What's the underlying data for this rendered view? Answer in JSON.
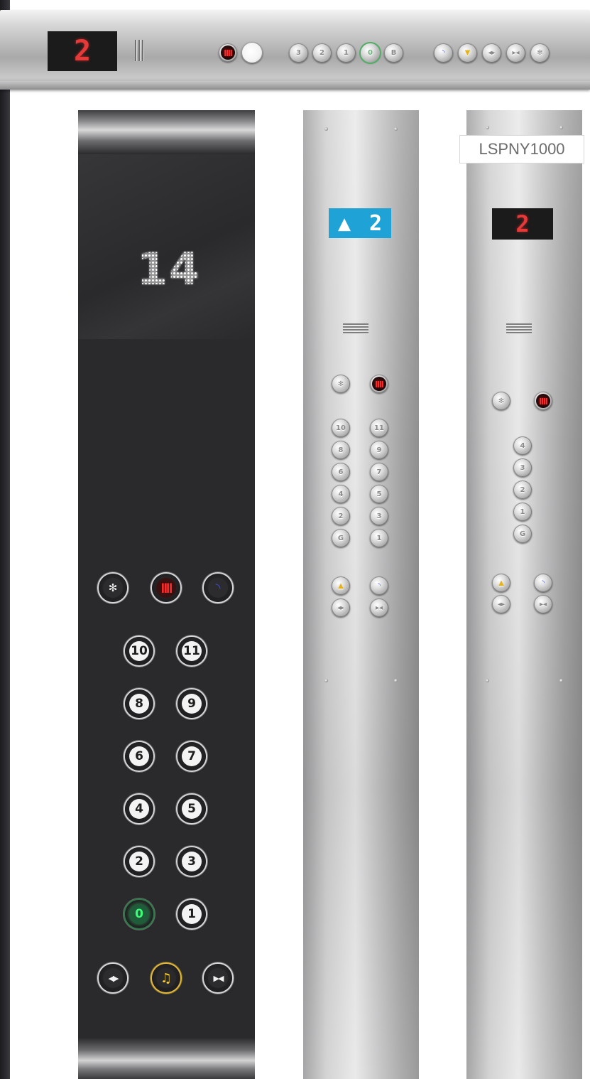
{
  "top_panel": {
    "floor_display": "2",
    "buttons": [
      "3",
      "2",
      "1",
      "0",
      "B"
    ],
    "right_buttons": [
      "",
      "",
      "",
      "",
      ""
    ]
  },
  "black_panel": {
    "floor_display": "14",
    "function_row": [
      {
        "name": "fan",
        "glyph": "✻",
        "style": "dark"
      },
      {
        "name": "alarm",
        "glyph": "ǁǁ",
        "style": "red"
      },
      {
        "name": "phone",
        "glyph": "◝",
        "style": "blue"
      }
    ],
    "floor_buttons": [
      [
        "10",
        "11"
      ],
      [
        "8",
        "9"
      ],
      [
        "6",
        "7"
      ],
      [
        "4",
        "5"
      ],
      [
        "2",
        "3"
      ],
      [
        "0",
        "1"
      ]
    ],
    "bottom_row": [
      {
        "name": "door-open",
        "glyph": "◀▶",
        "style": "dark"
      },
      {
        "name": "alarm-bell",
        "glyph": "♫",
        "style": "yellow"
      },
      {
        "name": "door-close",
        "glyph": "▶◀",
        "style": "dark"
      }
    ]
  },
  "steel_panel_1": {
    "direction_arrow": "▲",
    "floor_display": "2",
    "floor_buttons": [
      [
        "10",
        "11"
      ],
      [
        "8",
        "9"
      ],
      [
        "6",
        "7"
      ],
      [
        "4",
        "5"
      ],
      [
        "2",
        "3"
      ],
      [
        "G",
        "1"
      ]
    ]
  },
  "steel_panel_2": {
    "model_label": "LSPNY1000",
    "floor_display": "2",
    "floor_buttons": [
      "4",
      "3",
      "2",
      "1",
      "G"
    ]
  },
  "colors": {
    "red_led": "#e53a3a",
    "lcd_blue": "#1fa3d7",
    "green_led": "#3cff78",
    "yellow_led": "#ffd12a"
  }
}
